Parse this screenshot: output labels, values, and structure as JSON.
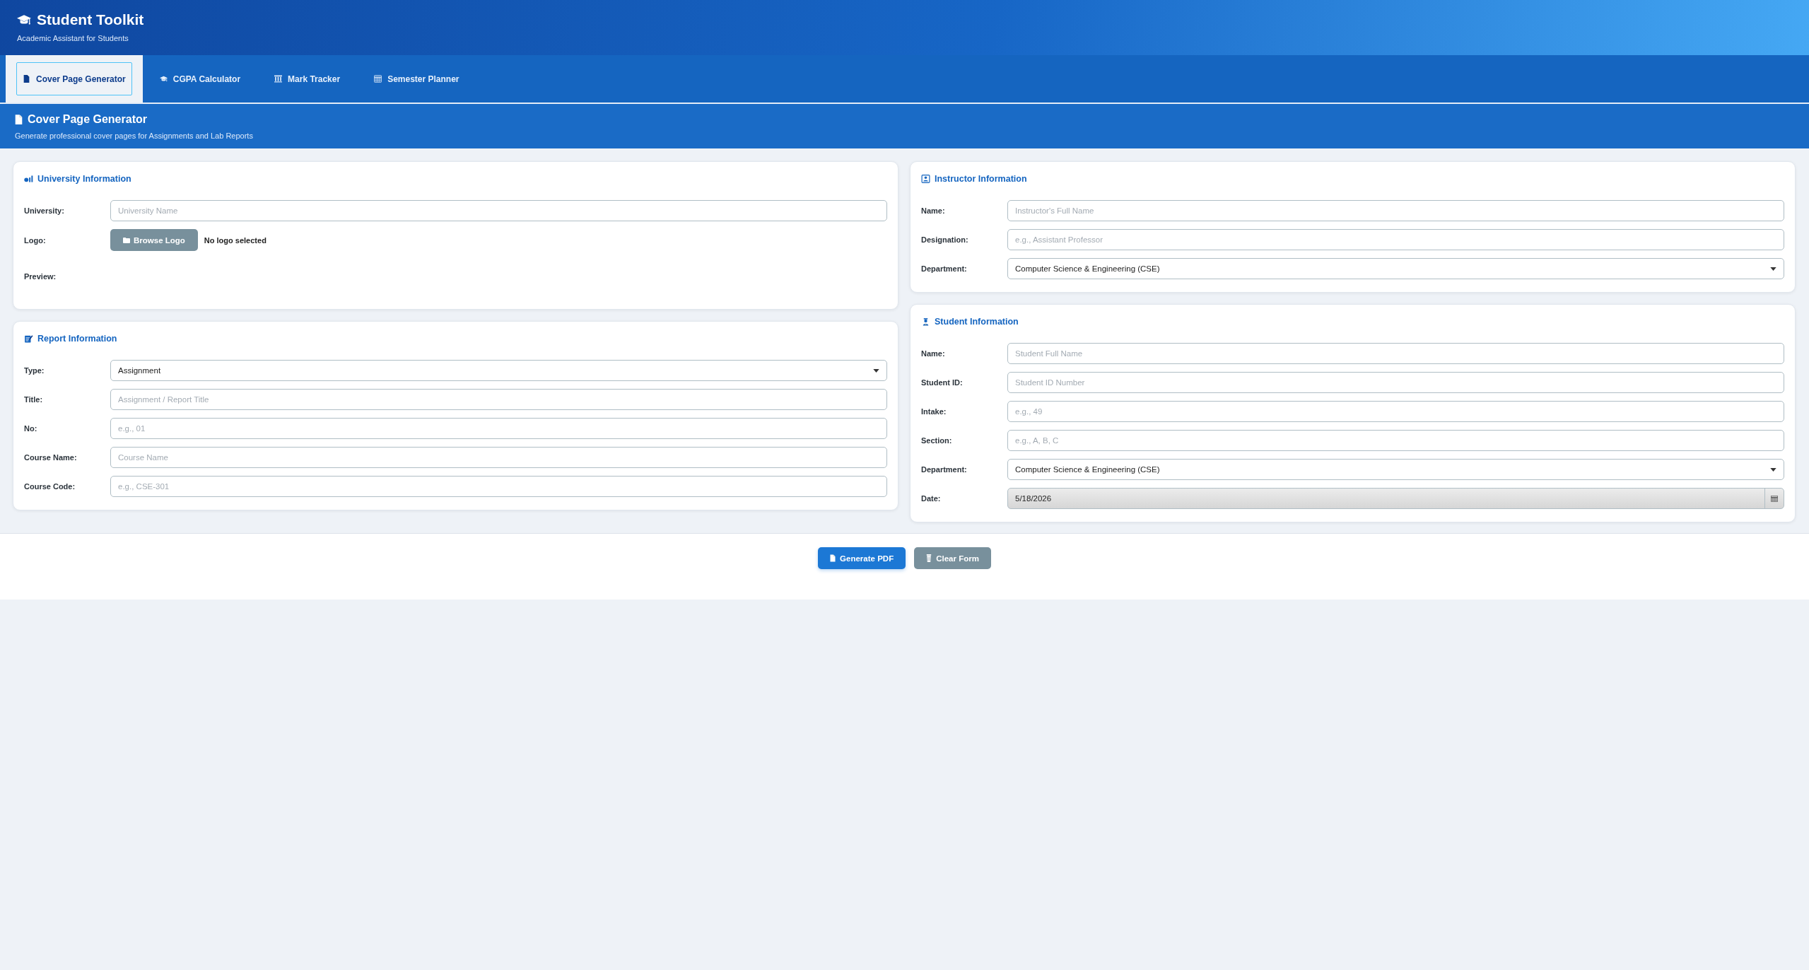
{
  "header": {
    "title": "Student Toolkit",
    "subtitle": "Academic Assistant for Students"
  },
  "tabs": [
    {
      "label": "Cover Page Generator",
      "selected": true
    },
    {
      "label": "CGPA Calculator",
      "selected": false
    },
    {
      "label": "Mark Tracker",
      "selected": false
    },
    {
      "label": "Semester Planner",
      "selected": false
    }
  ],
  "section": {
    "title": "Cover Page Generator",
    "subtitle": "Generate professional cover pages for Assignments and Lab Reports"
  },
  "left_column": [
    {
      "title": "University Information",
      "fields": [
        {
          "kind": "text",
          "label": "University:",
          "placeholder": "University Name"
        },
        {
          "kind": "file",
          "label": "Logo:",
          "button": "Browse Logo",
          "status": "No logo selected"
        },
        {
          "kind": "preview",
          "label": "Preview:"
        }
      ]
    },
    {
      "title": "Report Information",
      "fields": [
        {
          "kind": "select",
          "label": "Type:",
          "value": "Assignment"
        },
        {
          "kind": "text",
          "label": "Title:",
          "placeholder": "Assignment / Report Title"
        },
        {
          "kind": "text",
          "label": "No:",
          "placeholder": "e.g., 01"
        },
        {
          "kind": "text",
          "label": "Course Name:",
          "placeholder": "Course Name"
        },
        {
          "kind": "text",
          "label": "Course Code:",
          "placeholder": "e.g., CSE-301"
        }
      ]
    }
  ],
  "right_column": [
    {
      "title": "Instructor Information",
      "fields": [
        {
          "kind": "text",
          "label": "Name:",
          "placeholder": "Instructor's Full Name"
        },
        {
          "kind": "text",
          "label": "Designation:",
          "placeholder": "e.g., Assistant Professor"
        },
        {
          "kind": "select",
          "label": "Department:",
          "value": "Computer Science & Engineering (CSE)"
        }
      ]
    },
    {
      "title": "Student Information",
      "fields": [
        {
          "kind": "text",
          "label": "Name:",
          "placeholder": "Student Full Name"
        },
        {
          "kind": "text",
          "label": "Student ID:",
          "placeholder": "Student ID Number"
        },
        {
          "kind": "text",
          "label": "Intake:",
          "placeholder": "e.g., 49"
        },
        {
          "kind": "text",
          "label": "Section:",
          "placeholder": "e.g., A, B, C"
        },
        {
          "kind": "select",
          "label": "Department:",
          "value": "Computer Science & Engineering (CSE)"
        },
        {
          "kind": "date",
          "label": "Date:",
          "value": "5/18/2026"
        }
      ]
    }
  ],
  "actions": [
    {
      "kind": "primary",
      "label": "Generate PDF"
    },
    {
      "kind": "secondary",
      "label": "Clear Form"
    }
  ]
}
